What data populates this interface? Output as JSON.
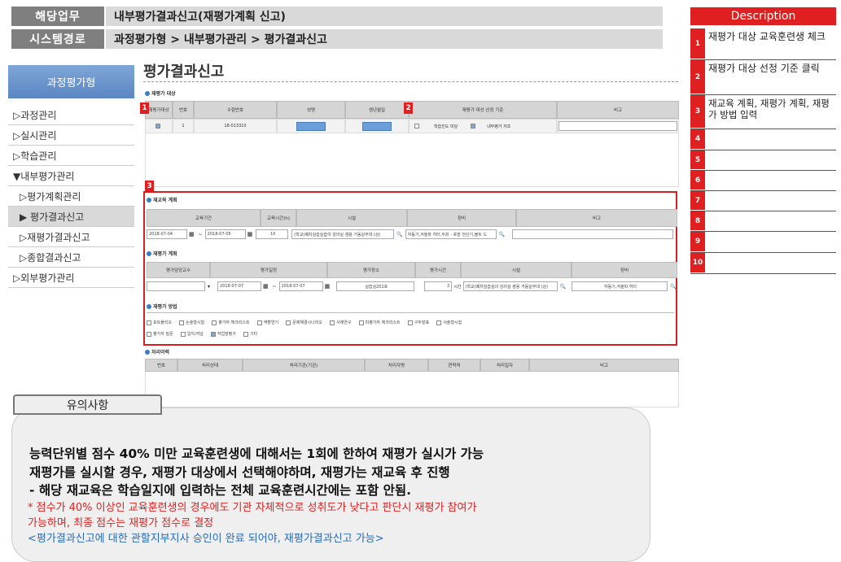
{
  "header": {
    "work_label": "해당업무",
    "work_value": "내부평가결과신고(재평가계획 신고)",
    "path_label": "시스템경로",
    "path_value": "과정평가형 > 내부평가관리 > 평가결과신고"
  },
  "sidebar": {
    "top": "과정평가형",
    "items": [
      {
        "label": "▷과정관리"
      },
      {
        "label": "▷실시관리"
      },
      {
        "label": "▷학습관리"
      },
      {
        "label": "▼내부평가관리"
      },
      {
        "label": "▷평가계획관리"
      },
      {
        "label": "▶ 평가결과신고"
      },
      {
        "label": "▷재평가결과신고"
      },
      {
        "label": "▷종합결과신고"
      },
      {
        "label": "▷외부평가관리"
      }
    ]
  },
  "main": {
    "title": "평가결과신고",
    "target": {
      "section": "재평가 대상",
      "headers": [
        "재평가대상",
        "번호",
        "수험번호",
        "성명",
        "생년월일",
        "재평가 대상 선정 기준",
        "비고"
      ],
      "row": {
        "num": "1",
        "exam_no": "18-013310",
        "criteria1": "학습진도 미달",
        "criteria2": "내부평가 저조"
      }
    },
    "reedu": {
      "section": "재교육 계획",
      "headers": [
        "교육기간",
        "교육시간(h)",
        "시설",
        "장비",
        "비고"
      ],
      "start": "2018-07-04",
      "end": "2018-07-05",
      "hours": "10",
      "facility": "(학교)폐차실습실습의 강의실 겸용 거동실무대 (상)",
      "equipment": "자동기,겨울파 히터,두피 - 포발 전단기,볼트 드"
    },
    "replan": {
      "section": "재평가 계획",
      "headers": [
        "평가담당교수",
        "평가일정",
        "평가장소",
        "평가시간",
        "시설",
        "장비"
      ],
      "start": "2018-07-07",
      "end": "2018-07-07",
      "place": "실습실201호",
      "time": "2",
      "time_unit": "시간",
      "facility": "(학교)폐차실습실의 강의실 겸용 거동실무대 (상)",
      "equipment": "자동기,겨울파 히터"
    },
    "method": {
      "section": "재평가 방법",
      "options": [
        "포트폴리오",
        "논술형시험",
        "평가자 체크리스트",
        "역할연기",
        "문제해결시나리오",
        "사례연구",
        "피평가자 체크리스트",
        "구두발표",
        "서술형시험",
        "평가자 질문",
        "일지/저널",
        "작업장평가",
        "기타"
      ]
    },
    "history": {
      "section": "처리이력",
      "headers": [
        "번호",
        "처리상태",
        "처리기관(기관)",
        "처리자명",
        "연락처",
        "처리일자",
        "비고"
      ]
    }
  },
  "markers": [
    "1",
    "2",
    "3"
  ],
  "description": {
    "title": "Description",
    "rows": [
      {
        "num": "1",
        "text": "재평가 대상 교육훈련생 체크"
      },
      {
        "num": "2",
        "text": "재평가 대상 선정 기준 클릭"
      },
      {
        "num": "3",
        "text": "재교육 계획, 재평가 계획, 재평가 방법 입력"
      },
      {
        "num": "4",
        "text": ""
      },
      {
        "num": "5",
        "text": ""
      },
      {
        "num": "6",
        "text": ""
      },
      {
        "num": "7",
        "text": ""
      },
      {
        "num": "8",
        "text": ""
      },
      {
        "num": "9",
        "text": ""
      },
      {
        "num": "10",
        "text": ""
      }
    ]
  },
  "notice": {
    "tab": "유의사항",
    "line1": "능력단위별 점수 40% 미만 교육훈련생에 대해서는 1회에 한하여 재평가 실시가 가능",
    "line2": "재평가를 실시할 경우, 재평가 대상에서 선택해야하며, 재평가는 재교육 후 진행",
    "line3": "- 해당 재교육은 학습일지에 입력하는 전체 교육훈련시간에는 포함 안됨.",
    "red1": "* 점수가 40% 이상인 교육훈련생의 경우에도 기관 자체적으로 성취도가 낮다고 판단시 재평가 참여가",
    "red2": "가능하며, 최종 점수는 재평가 점수로 결정",
    "blue": "<평가결과신고에 대한 관할지부지사 승인이 완료 되어야, 재평가결과신고 가능>"
  },
  "colors": {
    "accent_red": "#e02020",
    "header_gray": "#7f7f7f",
    "menu_blue": "#6b94cf",
    "note_blue": "#2a6bb8"
  }
}
